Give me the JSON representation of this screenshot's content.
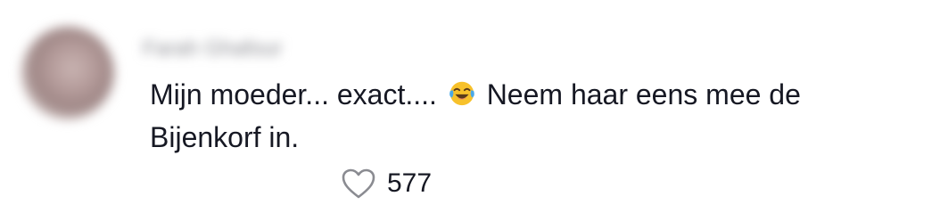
{
  "comment": {
    "username": "Farah Ghafour",
    "text_before_emoji": "Mijn moeder... exact.... ",
    "emoji": "laughing-tears-emoji",
    "text_after_emoji": " Neem haar eens mee de Bijenkorf in.",
    "likes": "577"
  },
  "icons": {
    "like": "heart-outline-icon"
  },
  "colors": {
    "text": "#161823",
    "muted": "#8a8b91",
    "icon": "#8a8b91",
    "emoji_face": "#f7c12b"
  }
}
